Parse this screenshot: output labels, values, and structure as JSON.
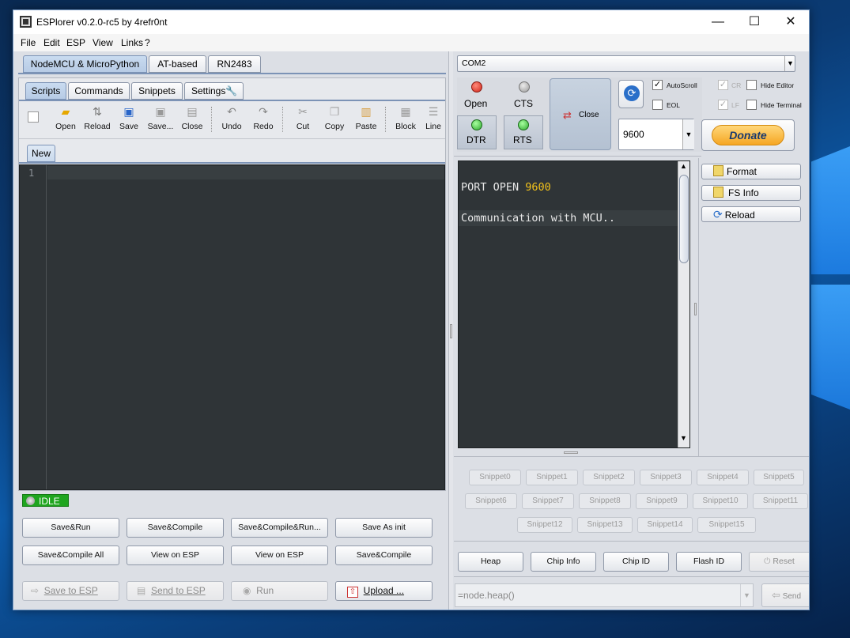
{
  "window": {
    "title": "ESPlorer v0.2.0-rc5 by 4refr0nt",
    "controls": {
      "minimize": "—",
      "maximize": "☐",
      "close": "✕"
    }
  },
  "menubar": [
    "File",
    "Edit",
    "ESP",
    "View",
    "Links",
    "?"
  ],
  "left": {
    "top_tabs": [
      "NodeMCU & MicroPython",
      "AT-based",
      "RN2483"
    ],
    "sub_tabs": [
      "Scripts",
      "Commands",
      "Snippets",
      "Settings"
    ],
    "toolbar": [
      {
        "label": "Open",
        "icon": "folder-icon"
      },
      {
        "label": "Reload",
        "icon": "reload-icon"
      },
      {
        "label": "Save",
        "icon": "floppy-icon"
      },
      {
        "label": "Save...",
        "icon": "floppy-gray-icon"
      },
      {
        "label": "Close",
        "icon": "close-file-icon"
      },
      {
        "label": "Undo",
        "icon": "undo-icon"
      },
      {
        "label": "Redo",
        "icon": "redo-icon"
      },
      {
        "label": "Cut",
        "icon": "scissors-icon"
      },
      {
        "label": "Copy",
        "icon": "copy-icon"
      },
      {
        "label": "Paste",
        "icon": "paste-icon"
      },
      {
        "label": "Block",
        "icon": "block-icon"
      },
      {
        "label": "Line",
        "icon": "line-icon"
      }
    ],
    "file_tab": "New",
    "editor": {
      "line_number": "1"
    },
    "status": "IDLE",
    "buttons_row1": [
      "Save&Run",
      "Save&Compile",
      "Save&Compile&Run...",
      "Save As init"
    ],
    "buttons_row2": [
      "Save&Compile All",
      "View on ESP",
      "View on ESP",
      "Save&Compile"
    ],
    "bottom_buttons": {
      "save_to_esp": "Save to ESP",
      "send_to_esp": "Send to ESP",
      "run": "Run",
      "upload": "Upload ..."
    }
  },
  "right": {
    "port": "COM2",
    "open_label": "Open",
    "cts_label": "CTS",
    "dtr_label": "DTR",
    "rts_label": "RTS",
    "close_label": "Close",
    "autoscroll_label": "AutoScroll",
    "eol_label": "EOL",
    "cr_label": "CR",
    "lf_label": "LF",
    "hide_editor_label": "Hide Editor",
    "hide_terminal_label": "Hide Terminal",
    "baud": "9600",
    "donate": "Donate",
    "terminal": {
      "line1_prefix": "PORT OPEN ",
      "line1_baud": "9600",
      "line2": "Communication with MCU.."
    },
    "side_buttons": [
      "Format",
      "FS Info",
      "Reload"
    ],
    "snippets": [
      "Snippet0",
      "Snippet1",
      "Snippet2",
      "Snippet3",
      "Snippet4",
      "Snippet5",
      "Snippet6",
      "Snippet7",
      "Snippet8",
      "Snippet9",
      "Snippet10",
      "Snippet11",
      "Snippet12",
      "Snippet13",
      "Snippet14",
      "Snippet15"
    ],
    "bottom_buttons": [
      "Heap",
      "Chip Info",
      "Chip ID",
      "Flash ID",
      "Reset"
    ],
    "command_input": "=node.heap()",
    "send_label": "Send"
  },
  "colors": {
    "accent": "#c9dbf0",
    "editor_bg": "#2f3437",
    "status_green": "#1fa51f",
    "donate": "#f5a623"
  }
}
